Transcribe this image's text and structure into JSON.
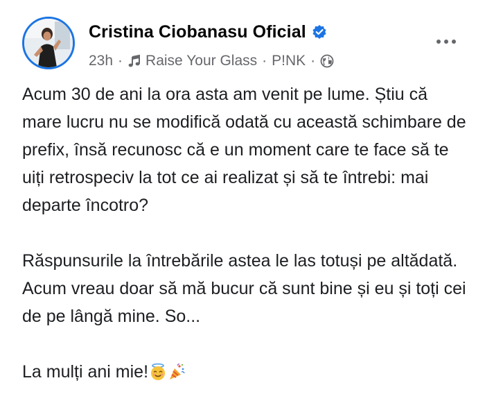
{
  "post": {
    "author_name": "Cristina Ciobanasu Oficial",
    "verified": true,
    "timestamp": "23h",
    "song": "Raise Your Glass",
    "artist": "P!NK",
    "separator": "·",
    "audience_icon": "globe-icon",
    "more_icon": "more-options-icon",
    "paragraphs": [
      "Acum 30 de ani la ora asta am venit pe lume. Știu că mare lucru nu se modifică odată cu această schimbare de prefix, însă recunosc că e un moment care te face să te uiți retrospeciv la tot ce ai realizat și să te întrebi: mai departe încotro?",
      "Răspunsurile la întrebările astea le las totuși pe altădată. Acum vreau doar să mă bucur că sunt bine și eu și toți cei de pe lângă mine. So..."
    ],
    "closing_line": "La mulți ani mie!",
    "closing_emojis": [
      "smiling-face-with-halo-emoji",
      "party-popper-emoji"
    ]
  },
  "colors": {
    "accent": "#1b74e4",
    "text_primary": "#050505",
    "text_secondary": "#65676b"
  }
}
